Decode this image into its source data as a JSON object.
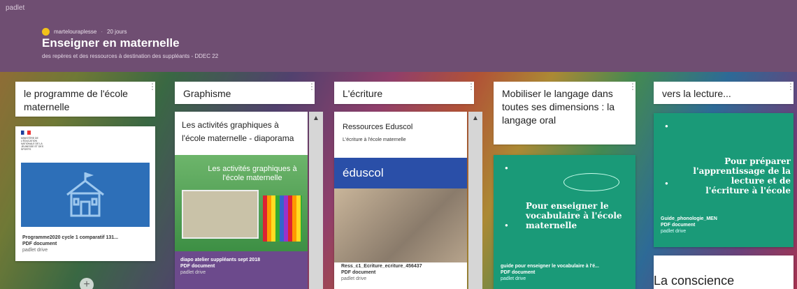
{
  "header": {
    "brand": "padlet",
    "author": "martelouraplesse",
    "age": "20 jours",
    "title": "Enseigner en maternelle",
    "subtitle": "des repères et des ressources à destination des suppléants - DDEC 22"
  },
  "columns": [
    {
      "title": "le programme de l'école maternelle",
      "card": {
        "file_name": "Programme2020 cycle 1 comparatif 131...",
        "type": "PDF document",
        "source": "padlet drive",
        "ministry": "MINISTÈRE DE L'ÉDUCATION NATIONALE DE LA JEUNESSE ET DES SPORTS"
      },
      "add": "+"
    },
    {
      "title": "Graphisme",
      "card": {
        "heading": "Les activités graphiques à l'école maternelle - diaporama",
        "image_text": "Les activités graphiques à l'école maternelle",
        "file_name": "diapo atelier suppléants sept 2018",
        "type": "PDF document",
        "source": "padlet drive"
      }
    },
    {
      "title": "L'écriture",
      "card": {
        "heading": "Ressources Eduscol",
        "caption": "L'écriture à l'école maternelle",
        "logo": "éduscol",
        "file_name": "Ress_c1_Ecriture_ecriture_456437",
        "type": "PDF document",
        "source": "padlet drive"
      }
    },
    {
      "title": "Mobiliser le langage dans toutes ses dimensions : la langage oral",
      "card": {
        "cover_text": "Pour enseigner le vocabulaire à l'école maternelle",
        "file_name": "guide pour enseigner le vocabulaire à l'é...",
        "type": "PDF document",
        "source": "padlet drive"
      }
    },
    {
      "title": "vers la lecture...",
      "card": {
        "cover_text": "Pour préparer l'apprentissage de la lecture et de l'écriture à l'école",
        "file_name": "Guide_phonologie_MEN",
        "type": "PDF document",
        "source": "padlet drive"
      },
      "next_card": "La conscience"
    }
  ],
  "ui": {
    "menu_glyph": "⋮",
    "scroll_up_glyph": "▲"
  },
  "colors": {
    "header_bg": "#6f4e72",
    "cover_green": "#1a9a78",
    "graphisme_purple": "#6c4a8c",
    "eduscol_blue": "#2a4fa8",
    "ministry_blue": "#2d6fb8"
  }
}
